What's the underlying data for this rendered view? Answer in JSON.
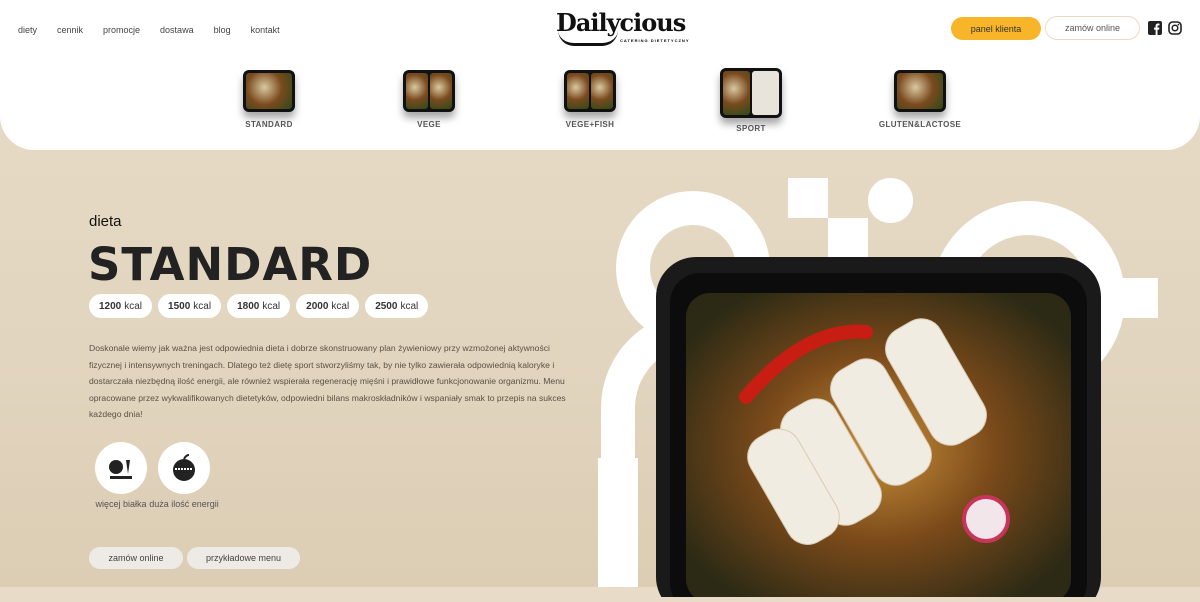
{
  "nav": [
    "diety",
    "cennik",
    "promocje",
    "dostawa",
    "blog",
    "kontakt"
  ],
  "logo": {
    "name": "Dailycious",
    "subtitle": "CATERING DIETETYCZNY"
  },
  "header_buttons": {
    "panel": "panel klienta",
    "order": "zamów online"
  },
  "social": [
    "facebook-icon",
    "instagram-icon"
  ],
  "diets": [
    "STANDARD",
    "VEGE",
    "VEGE+FISH",
    "SPORT",
    "GLUTEN&LACTOSE"
  ],
  "hero": {
    "pre": "dieta",
    "title": "STANDARD"
  },
  "kcal": [
    {
      "v": "1200",
      "u": "kcal"
    },
    {
      "v": "1500",
      "u": "kcal"
    },
    {
      "v": "1800",
      "u": "kcal"
    },
    {
      "v": "2000",
      "u": "kcal"
    },
    {
      "v": "2500",
      "u": "kcal"
    }
  ],
  "description": "Doskonale wiemy jak ważna jest odpowiednia dieta i dobrze skonstruowany plan żywieniowy przy wzmożonej aktywności fizycznej i intensywnych treningach. Dlatego też dietę sport stworzyliśmy tak, by nie tylko zawierała odpowiednią kaloryke i dostarczała niezbędną ilość energii, ale również wspierała regenerację mięśni i prawidłowe funkcjonowanie organizmu. Menu opracowane przez wykwalifikowanych dietetyków, odpowiedni bilans makroskładników i wspaniały smak to przepis na sukces każdego dnia!",
  "features": [
    {
      "label": "więcej białka"
    },
    {
      "label": "duża ilość energii"
    }
  ],
  "actions": {
    "order": "zamów online",
    "menu": "przykładowe menu"
  },
  "colors": {
    "accent": "#f9b529",
    "bg": "#e6d9c4"
  }
}
